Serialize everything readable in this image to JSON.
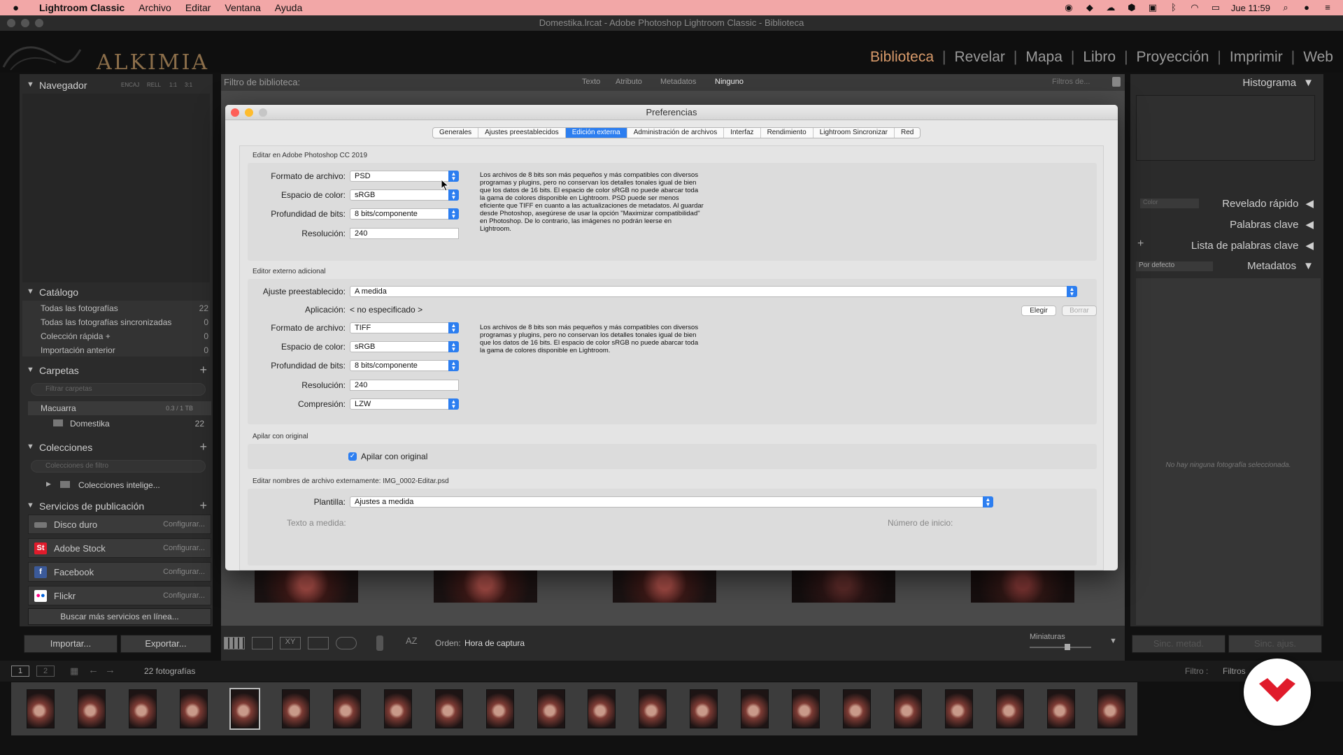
{
  "menubar": {
    "app": "Lightroom Classic",
    "items": [
      "Archivo",
      "Editar",
      "Ventana",
      "Ayuda"
    ],
    "clock": "Jue 11:59"
  },
  "window": {
    "title": "Domestika.lrcat - Adobe Photoshop Lightroom Classic - Biblioteca"
  },
  "identity": {
    "logo": "ALKIMIA"
  },
  "modules": [
    "Biblioteca",
    "Revelar",
    "Mapa",
    "Libro",
    "Proyección",
    "Imprimir",
    "Web"
  ],
  "left": {
    "navigator": {
      "title": "Navegador",
      "zoom_labels": [
        "ENCAJ",
        "RELL",
        "1:1",
        "3:1"
      ]
    },
    "catalog": {
      "title": "Catálogo",
      "rows": [
        {
          "label": "Todas las fotografías",
          "count": "22"
        },
        {
          "label": "Todas las fotografías sincronizadas",
          "count": "0"
        },
        {
          "label": "Colección rápida +",
          "count": "0"
        },
        {
          "label": "Importación anterior",
          "count": "0"
        }
      ]
    },
    "folders": {
      "title": "Carpetas",
      "search_placeholder": "Filtrar carpetas",
      "volume": "Macuarra",
      "volume_size": "0.3 / 1 TB",
      "folder": "Domestika",
      "folder_count": "22"
    },
    "collections": {
      "title": "Colecciones",
      "search_placeholder": "Colecciones de filtro",
      "item": "Colecciones intelige..."
    },
    "publish": {
      "title": "Servicios de publicación",
      "services": [
        {
          "name": "Disco duro",
          "action": "Configurar..."
        },
        {
          "name": "Adobe Stock",
          "action": "Configurar..."
        },
        {
          "name": "Facebook",
          "action": "Configurar..."
        },
        {
          "name": "Flickr",
          "action": "Configurar..."
        }
      ],
      "more": "Buscar más servicios en línea..."
    },
    "import": "Importar...",
    "export": "Exportar..."
  },
  "filterbar": {
    "label": "Filtro de biblioteca:",
    "options": [
      "Texto",
      "Atributo",
      "Metadatos",
      "Ninguno"
    ],
    "active": "Ninguno",
    "presets": "Filtros de..."
  },
  "toolbar": {
    "sort_label": "Orden:",
    "sort_value": "Hora de captura",
    "thumbs_label": "Miniaturas"
  },
  "right": {
    "histogram": "Histograma",
    "quick_develop": "Revelado rápido",
    "quick_develop_preset": "Color",
    "keywording": "Palabras clave",
    "keyword_list": "Lista de palabras clave",
    "metadata": "Metadatos",
    "metadata_preset": "Por defecto",
    "empty_message": "No hay ninguna fotografía seleccionada.",
    "sync_meta": "Sinc. metad.",
    "sync_settings": "Sinc. ajus."
  },
  "filmstrip": {
    "count": "22 fotografías",
    "filter_label": "Filtro :",
    "filter_value": "Filtros"
  },
  "dialog": {
    "title": "Preferencias",
    "tabs": [
      "Generales",
      "Ajustes preestablecidos",
      "Edición externa",
      "Administración de archivos",
      "Interfaz",
      "Rendimiento",
      "Lightroom Sincronizar",
      "Red"
    ],
    "active_tab": "Edición externa",
    "section1": {
      "title": "Editar en Adobe Photoshop CC 2019",
      "labels": {
        "format": "Formato de archivo:",
        "color": "Espacio de color:",
        "depth": "Profundidad de bits:",
        "res": "Resolución:"
      },
      "format": "PSD",
      "color": "sRGB",
      "depth": "8 bits/componente",
      "res": "240",
      "help": "Los archivos de 8 bits son más pequeños y más compatibles con diversos programas y plugins, pero no conservan los detalles tonales igual de bien que los datos de 16 bits. El espacio de color sRGB no puede abarcar toda la gama de colores disponible en Lightroom. PSD puede ser menos eficiente que TIFF en cuanto a las actualizaciones de metadatos. Al guardar desde Photoshop, asegúrese de usar la opción \"Maximizar compatibilidad\" en Photoshop. De lo contrario, las imágenes no podrán leerse en Lightroom."
    },
    "section2": {
      "title": "Editor externo adicional",
      "labels": {
        "preset": "Ajuste preestablecido:",
        "app": "Aplicación:",
        "format": "Formato de archivo:",
        "color": "Espacio de color:",
        "depth": "Profundidad de bits:",
        "res": "Resolución:",
        "compression": "Compresión:"
      },
      "preset": "A medida",
      "app": "< no especificado >",
      "choose": "Elegir",
      "clear": "Borrar",
      "format": "TIFF",
      "color": "sRGB",
      "depth": "8 bits/componente",
      "res": "240",
      "compression": "LZW",
      "help": "Los archivos de 8 bits son más pequeños y más compatibles con diversos programas y plugins, pero no conservan los detalles tonales igual de bien que los datos de 16 bits. El espacio de color sRGB no puede abarcar toda la gama de colores disponible en Lightroom."
    },
    "section3": {
      "title": "Apilar con original",
      "checkbox": "Apilar con original"
    },
    "section4": {
      "title": "Editar nombres de archivo externamente: IMG_0002-Editar.psd",
      "template_label": "Plantilla:",
      "template": "Ajustes a medida",
      "custom_text": "Texto a medida:",
      "start_number": "Número de inicio:"
    }
  },
  "colors": {
    "accent_blue": "#2c7ef0",
    "module_active": "#d89a6a",
    "brand_red": "#e01b2b"
  }
}
